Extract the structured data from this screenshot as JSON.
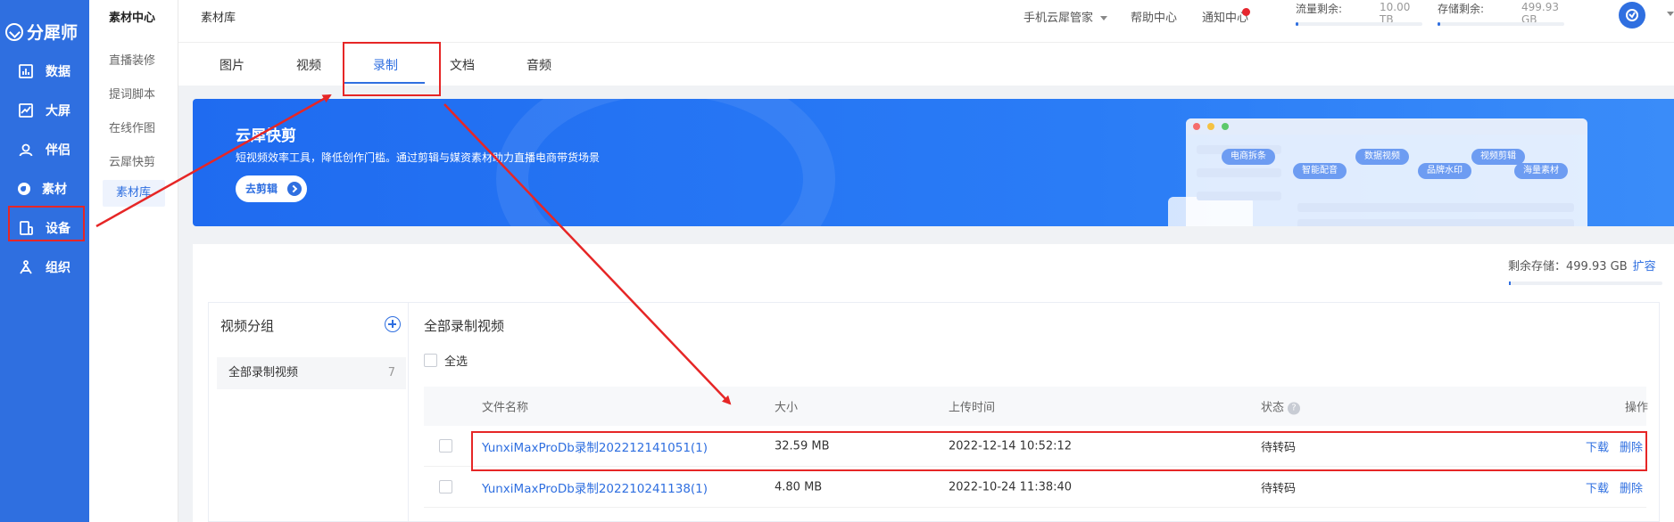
{
  "app": {
    "logo_text": "分犀师"
  },
  "nav": {
    "items": [
      {
        "label": "数据",
        "icon": "bar-chart-icon"
      },
      {
        "label": "大屏",
        "icon": "trend-chart-icon"
      },
      {
        "label": "伴侣",
        "icon": "user-icon"
      },
      {
        "label": "素材",
        "icon": "material-icon"
      },
      {
        "label": "设备",
        "icon": "device-icon"
      },
      {
        "label": "组织",
        "icon": "org-icon"
      }
    ],
    "active": "素材"
  },
  "subnav": {
    "header": "素材中心",
    "items": [
      "直播装修",
      "提词脚本",
      "在线作图",
      "云犀快剪",
      "素材库"
    ],
    "active": "素材库"
  },
  "topbar": {
    "breadcrumb": "素材库",
    "phone_manager": "手机云犀管家",
    "help_center": "帮助中心",
    "notice_center": "通知中心",
    "traffic_label": "流量剩余:",
    "traffic_value": "10.00 TB",
    "storage_label": "存储剩余:",
    "storage_value": "499.93 GB"
  },
  "tabs": [
    "图片",
    "视频",
    "录制",
    "文档",
    "音频"
  ],
  "active_tab": "录制",
  "banner": {
    "title": "云犀快剪",
    "desc": "短视频效率工具，降低创作门槛。通过剪辑与媒资素材助力直播电商带货场景",
    "button": "去剪辑",
    "chips": [
      "电商拆条",
      "数据视频",
      "视频剪辑",
      "智能配音",
      "品牌水印",
      "海量素材"
    ]
  },
  "storage": {
    "label": "剩余存储：499.93 GB",
    "expand": "扩容"
  },
  "groups": {
    "title": "视频分组",
    "items": [
      {
        "name": "全部录制视频",
        "count": "7"
      }
    ]
  },
  "list": {
    "title": "全部录制视频",
    "select_all": "全选",
    "columns": {
      "name": "文件名称",
      "size": "大小",
      "time": "上传时间",
      "status": "状态",
      "ops": "操作"
    },
    "rows": [
      {
        "name": "YunxiMaxProDb录制202212141051(1)",
        "size": "32.59 MB",
        "time": "2022-12-14 10:52:12",
        "status": "待转码",
        "download": "下载",
        "delete": "删除"
      },
      {
        "name": "YunxiMaxProDb录制202210241138(1)",
        "size": "4.80 MB",
        "time": "2022-10-24 11:38:40",
        "status": "待转码",
        "download": "下载",
        "delete": "删除"
      }
    ]
  },
  "colors": {
    "brand": "#2f6fe0",
    "annotation": "#e62626"
  }
}
